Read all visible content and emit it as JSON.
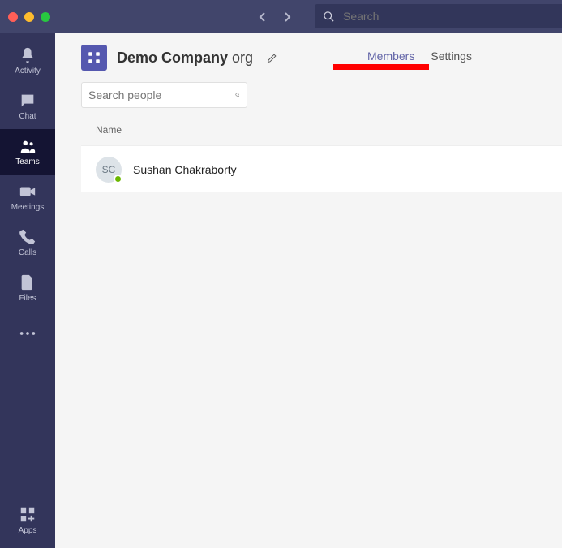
{
  "titlebar": {
    "search_placeholder": "Search"
  },
  "siderail": {
    "items": [
      {
        "label": "Activity",
        "icon": "bell"
      },
      {
        "label": "Chat",
        "icon": "chat"
      },
      {
        "label": "Teams",
        "icon": "teams",
        "active": true
      },
      {
        "label": "Meetings",
        "icon": "meetings"
      },
      {
        "label": "Calls",
        "icon": "calls"
      },
      {
        "label": "Files",
        "icon": "files"
      }
    ],
    "apps_label": "Apps"
  },
  "team": {
    "name_bold": "Demo Company",
    "name_suffix": "org"
  },
  "tabs": {
    "members": "Members",
    "settings": "Settings",
    "active": "members"
  },
  "search_people": {
    "placeholder": "Search people"
  },
  "members": {
    "name_header": "Name",
    "rows": [
      {
        "initials": "SC",
        "name": "Sushan Chakraborty",
        "presence": "available"
      }
    ]
  },
  "colors": {
    "accent": "#6264a7",
    "highlight": "#ff0000",
    "presence_available": "#6bb700"
  }
}
